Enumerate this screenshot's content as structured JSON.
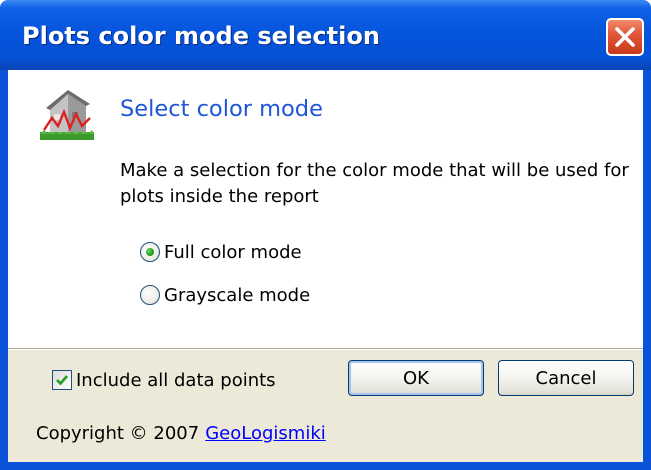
{
  "window": {
    "title": "Plots color mode selection"
  },
  "header": {
    "icon": "house-chart-icon",
    "heading": "Select color mode"
  },
  "description": "Make a selection for the color mode that will be used for plots inside the report",
  "color_modes": [
    {
      "label": "Full color mode",
      "selected": true
    },
    {
      "label": "Grayscale mode",
      "selected": false
    }
  ],
  "include_all": {
    "label": "Include all data points",
    "checked": true
  },
  "buttons": {
    "ok": "OK",
    "cancel": "Cancel"
  },
  "footer": {
    "copyright": "Copyright © 2007",
    "link": "GeoLogismiki"
  },
  "colors": {
    "titlebar": "#0554dc",
    "heading": "#1f56d8",
    "dialog_bg": "#ece9d8",
    "link": "#0000ff"
  }
}
